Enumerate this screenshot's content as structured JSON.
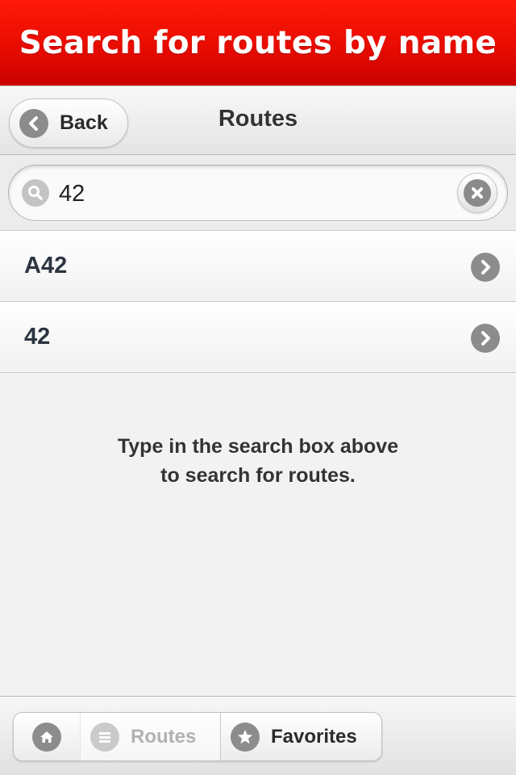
{
  "banner": {
    "title": "Search for routes by name"
  },
  "header": {
    "back_label": "Back",
    "title": "Routes"
  },
  "search": {
    "value": "42"
  },
  "results": [
    {
      "label": "A42"
    },
    {
      "label": "42"
    }
  ],
  "hint": {
    "line1": "Type in the search box above",
    "line2": "to search for routes."
  },
  "nav": {
    "home_icon": "home-icon",
    "routes_label": "Routes",
    "routes_state": "disabled",
    "favorites_label": "Favorites"
  },
  "colors": {
    "banner_red": "#e80c00",
    "icon_gray": "#8c8c8c",
    "text_dark": "#2c3540"
  }
}
